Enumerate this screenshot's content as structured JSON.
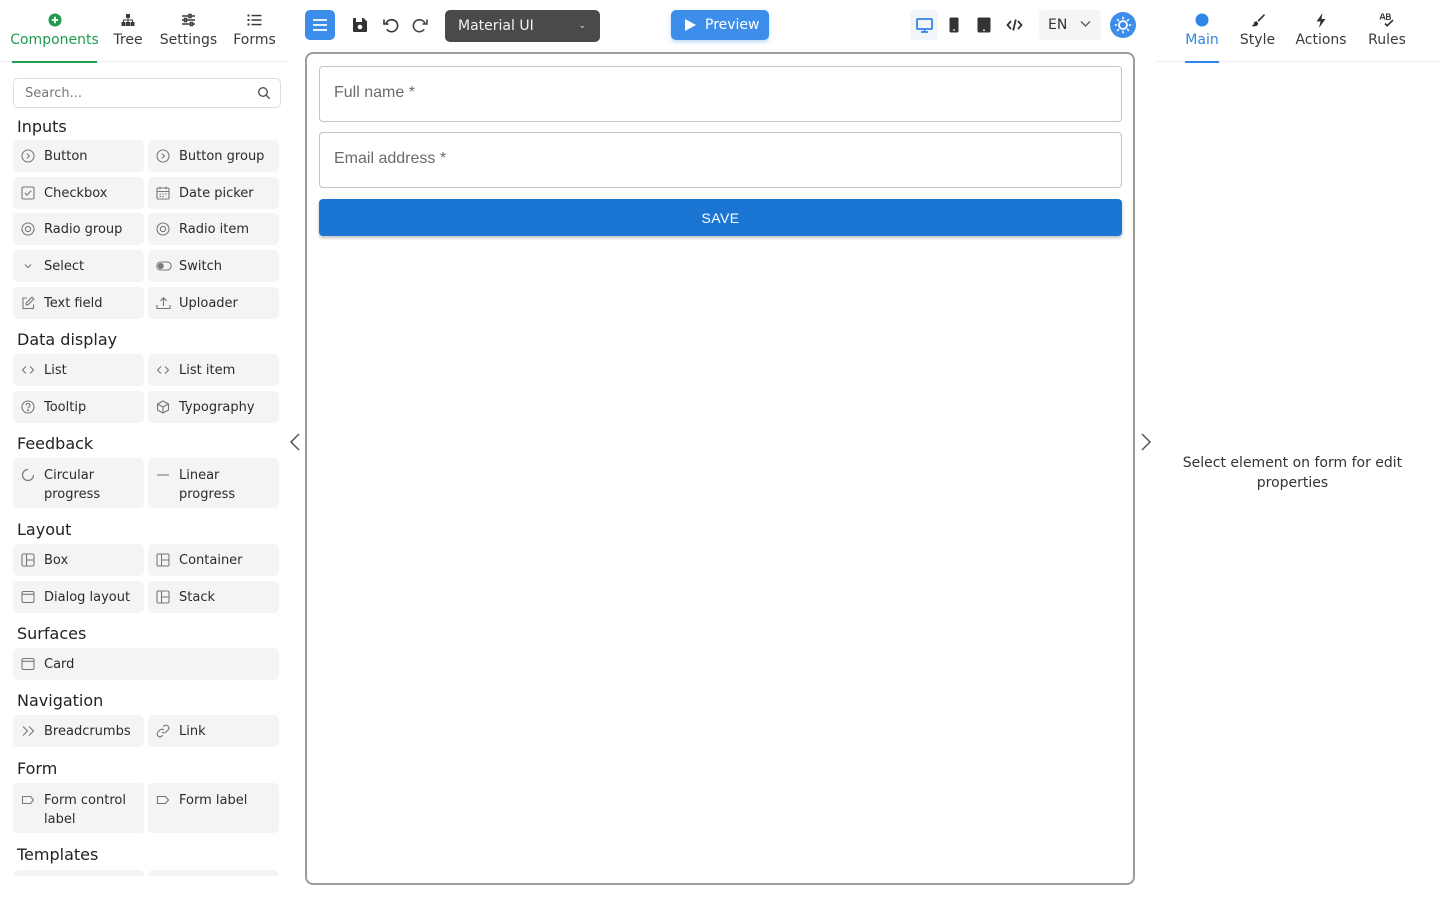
{
  "left_tabs": [
    {
      "label": "Components",
      "icon": "plus-circle-icon",
      "active": true
    },
    {
      "label": "Tree",
      "icon": "tree-icon",
      "active": false
    },
    {
      "label": "Settings",
      "icon": "sliders-icon",
      "active": false
    },
    {
      "label": "Forms",
      "icon": "list-icon",
      "active": false
    }
  ],
  "search": {
    "placeholder": "Search..."
  },
  "categories": {
    "inputs": {
      "title": "Inputs",
      "items": [
        {
          "label": "Button",
          "icon": "circle-play-icon"
        },
        {
          "label": "Button group",
          "icon": "circle-play-icon"
        },
        {
          "label": "Checkbox",
          "icon": "checkbox-icon"
        },
        {
          "label": "Date picker",
          "icon": "calendar-icon"
        },
        {
          "label": "Radio group",
          "icon": "radio-icon"
        },
        {
          "label": "Radio item",
          "icon": "radio-icon"
        },
        {
          "label": "Select",
          "icon": "chevron-down-icon"
        },
        {
          "label": "Switch",
          "icon": "toggle-icon"
        },
        {
          "label": "Text field",
          "icon": "edit-icon"
        },
        {
          "label": "Uploader",
          "icon": "upload-icon"
        }
      ]
    },
    "data_display": {
      "title": "Data display",
      "items": [
        {
          "label": "List",
          "icon": "code-icon"
        },
        {
          "label": "List item",
          "icon": "code-icon"
        },
        {
          "label": "Tooltip",
          "icon": "question-circle-icon"
        },
        {
          "label": "Typography",
          "icon": "cube-icon"
        }
      ]
    },
    "feedback": {
      "title": "Feedback",
      "items": [
        {
          "label": "Circular progress",
          "icon": "spinner-icon"
        },
        {
          "label": "Linear progress",
          "icon": "minus-icon"
        }
      ]
    },
    "layout": {
      "title": "Layout",
      "items": [
        {
          "label": "Box",
          "icon": "layout-icon"
        },
        {
          "label": "Container",
          "icon": "layout-icon"
        },
        {
          "label": "Dialog layout",
          "icon": "window-icon"
        },
        {
          "label": "Stack",
          "icon": "layout-icon"
        }
      ]
    },
    "surfaces": {
      "title": "Surfaces",
      "items": [
        {
          "label": "Card",
          "icon": "window-icon"
        }
      ]
    },
    "navigation": {
      "title": "Navigation",
      "items": [
        {
          "label": "Breadcrumbs",
          "icon": "double-chevron-icon"
        },
        {
          "label": "Link",
          "icon": "link-icon"
        }
      ]
    },
    "form": {
      "title": "Form",
      "items": [
        {
          "label": "Form control label",
          "icon": "tag-icon"
        },
        {
          "label": "Form label",
          "icon": "tag-icon"
        }
      ]
    },
    "templates": {
      "title": "Templates",
      "items": []
    }
  },
  "toolbar": {
    "theme_select": "Material UI",
    "preview_label": "Preview",
    "language": "EN",
    "accent_color": "#3d8eea"
  },
  "canvas": {
    "fields": [
      {
        "label": "Full name *"
      },
      {
        "label": "Email address *"
      }
    ],
    "save_label": "SAVE",
    "save_color": "#1a76d2"
  },
  "right_tabs": [
    {
      "label": "Main",
      "icon": "circle-icon",
      "active": true
    },
    {
      "label": "Style",
      "icon": "brush-icon",
      "active": false
    },
    {
      "label": "Actions",
      "icon": "bolt-icon",
      "active": false
    },
    {
      "label": "Rules",
      "icon": "spellcheck-icon",
      "active": false
    }
  ],
  "right_panel": {
    "empty_message": "Select element on form for edit properties"
  }
}
